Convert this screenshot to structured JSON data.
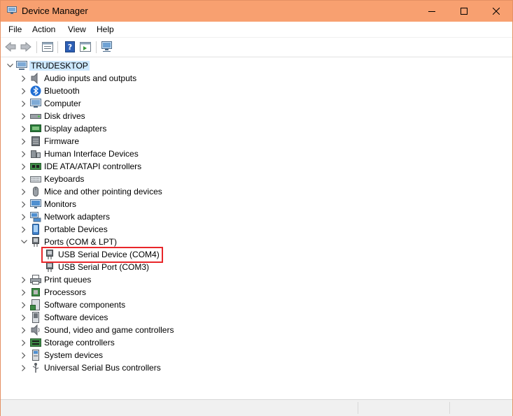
{
  "window": {
    "title": "Device Manager"
  },
  "menu": [
    "File",
    "Action",
    "View",
    "Help"
  ],
  "tree": {
    "root": "TRUDESKTOP",
    "categories": [
      {
        "label": "Audio inputs and outputs",
        "icon": "speaker-icon",
        "expanded": false
      },
      {
        "label": "Bluetooth",
        "icon": "bluetooth-icon",
        "expanded": false
      },
      {
        "label": "Computer",
        "icon": "computer-icon",
        "expanded": false
      },
      {
        "label": "Disk drives",
        "icon": "disk-drive-icon",
        "expanded": false
      },
      {
        "label": "Display adapters",
        "icon": "display-adapter-icon",
        "expanded": false
      },
      {
        "label": "Firmware",
        "icon": "firmware-icon",
        "expanded": false
      },
      {
        "label": "Human Interface Devices",
        "icon": "hid-icon",
        "expanded": false
      },
      {
        "label": "IDE ATA/ATAPI controllers",
        "icon": "ide-controller-icon",
        "expanded": false
      },
      {
        "label": "Keyboards",
        "icon": "keyboard-icon",
        "expanded": false
      },
      {
        "label": "Mice and other pointing devices",
        "icon": "mouse-icon",
        "expanded": false
      },
      {
        "label": "Monitors",
        "icon": "monitor-icon",
        "expanded": false
      },
      {
        "label": "Network adapters",
        "icon": "network-adapter-icon",
        "expanded": false
      },
      {
        "label": "Portable Devices",
        "icon": "portable-device-icon",
        "expanded": false
      },
      {
        "label": "Ports (COM & LPT)",
        "icon": "port-icon",
        "expanded": true,
        "children": [
          {
            "label": "USB Serial Device (COM4)",
            "icon": "port-icon",
            "highlighted": true
          },
          {
            "label": "USB Serial Port (COM3)",
            "icon": "port-icon",
            "highlighted": false
          }
        ]
      },
      {
        "label": "Print queues",
        "icon": "printer-icon",
        "expanded": false
      },
      {
        "label": "Processors",
        "icon": "processor-icon",
        "expanded": false
      },
      {
        "label": "Software components",
        "icon": "software-component-icon",
        "expanded": false
      },
      {
        "label": "Software devices",
        "icon": "software-device-icon",
        "expanded": false
      },
      {
        "label": "Sound, video and game controllers",
        "icon": "sound-controller-icon",
        "expanded": false
      },
      {
        "label": "Storage controllers",
        "icon": "storage-controller-icon",
        "expanded": false
      },
      {
        "label": "System devices",
        "icon": "system-device-icon",
        "expanded": false
      },
      {
        "label": "Universal Serial Bus controllers",
        "icon": "usb-controller-icon",
        "expanded": false
      }
    ]
  },
  "colors": {
    "titlebar": "#f8a070",
    "selection": "#cce8ff",
    "highlight_border": "#e8262a"
  }
}
